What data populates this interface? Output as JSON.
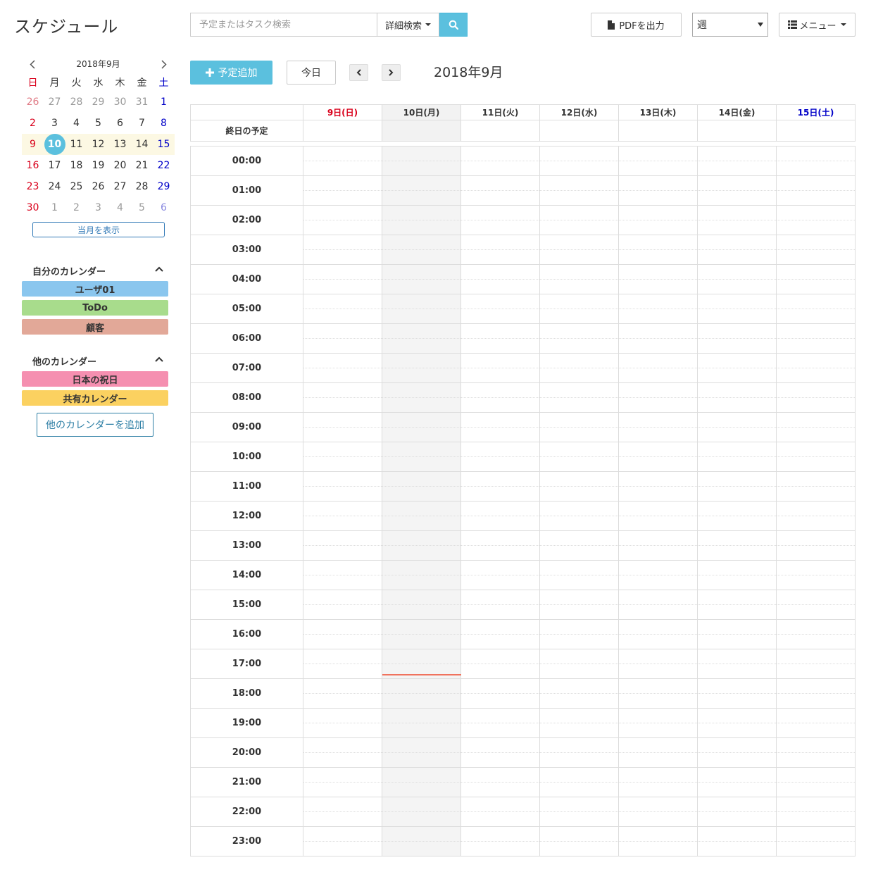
{
  "app": {
    "title": "スケジュール"
  },
  "search": {
    "placeholder": "予定またはタスク検索",
    "advanced_label": "詳細検索"
  },
  "toolbar": {
    "pdf_label": "PDFを出力",
    "view_value": "週",
    "menu_label": "メニュー"
  },
  "mini_calendar": {
    "title": "2018年9月",
    "weekdays": [
      "日",
      "月",
      "火",
      "水",
      "木",
      "金",
      "土"
    ],
    "weeks": [
      [
        "26",
        "27",
        "28",
        "29",
        "30",
        "31",
        "1"
      ],
      [
        "2",
        "3",
        "4",
        "5",
        "6",
        "7",
        "8"
      ],
      [
        "9",
        "10",
        "11",
        "12",
        "13",
        "14",
        "15"
      ],
      [
        "16",
        "17",
        "18",
        "19",
        "20",
        "21",
        "22"
      ],
      [
        "23",
        "24",
        "25",
        "26",
        "27",
        "28",
        "29"
      ],
      [
        "30",
        "1",
        "2",
        "3",
        "4",
        "5",
        "6"
      ]
    ],
    "today": "10",
    "show_month_label": "当月を表示"
  },
  "my_calendars": {
    "title": "自分のカレンダー",
    "items": [
      {
        "label": "ユーザ01",
        "color": "#8ac6ee"
      },
      {
        "label": "ToDo",
        "color": "#a8dc8c"
      },
      {
        "label": "顧客",
        "color": "#e2a898"
      }
    ]
  },
  "other_calendars": {
    "title": "他のカレンダー",
    "items": [
      {
        "label": "日本の祝日",
        "color": "#f58fb0"
      },
      {
        "label": "共有カレンダー",
        "color": "#fbd160"
      }
    ],
    "add_label": "他のカレンダーを追加"
  },
  "main": {
    "add_label": "予定追加",
    "today_label": "今日",
    "current_label": "2018年9月",
    "allday_label": "終日の予定",
    "days": [
      "9日(日)",
      "10日(月)",
      "11日(火)",
      "12日(水)",
      "13日(木)",
      "14日(金)",
      "15日(土)"
    ],
    "hours": [
      "00:00",
      "01:00",
      "02:00",
      "03:00",
      "04:00",
      "05:00",
      "06:00",
      "07:00",
      "08:00",
      "09:00",
      "10:00",
      "11:00",
      "12:00",
      "13:00",
      "14:00",
      "15:00",
      "16:00",
      "17:00",
      "18:00",
      "19:00",
      "20:00",
      "21:00",
      "22:00",
      "23:00"
    ],
    "now_time": "17:51"
  },
  "colors": {
    "accent": "#5bc0de",
    "now_line": "#f0735e",
    "today_bg": "#f2f2f2"
  }
}
